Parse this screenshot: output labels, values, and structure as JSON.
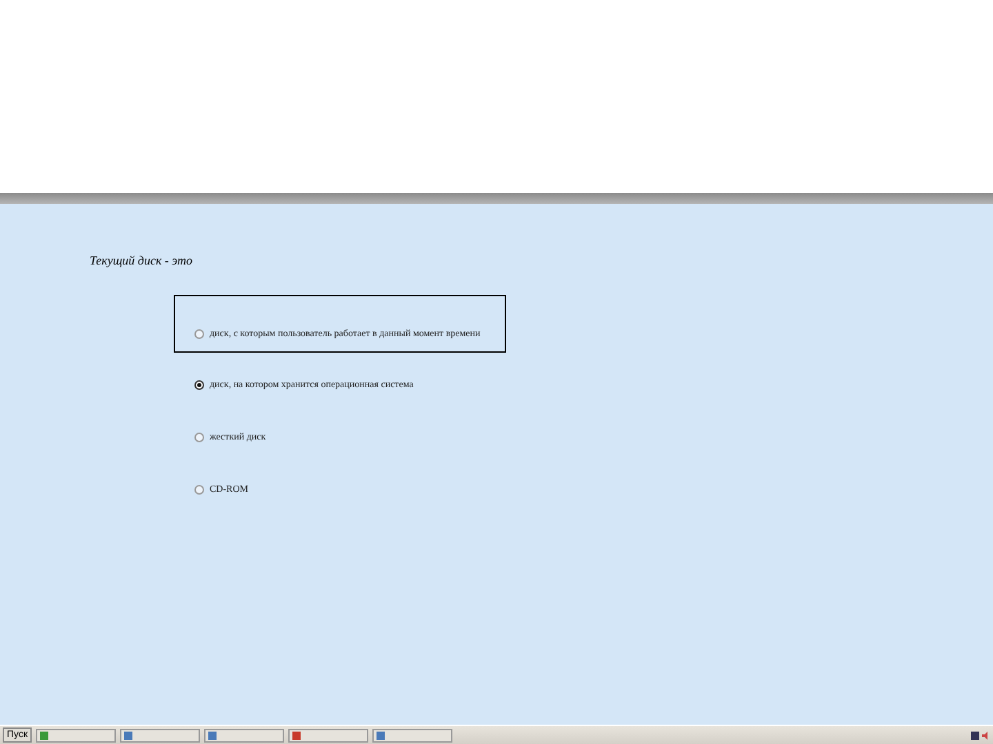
{
  "question": {
    "text": "Текущий диск - это"
  },
  "options": [
    {
      "label": "диск, с которым пользователь работает в данный момент времени",
      "selected": false,
      "highlighted": true
    },
    {
      "label": "диск, на котором хранится операционная система",
      "selected": true,
      "highlighted": false
    },
    {
      "label": "жесткий диск",
      "selected": false,
      "highlighted": false
    },
    {
      "label": "CD-ROM",
      "selected": false,
      "highlighted": false
    }
  ],
  "taskbar": {
    "start": "Пуск"
  }
}
